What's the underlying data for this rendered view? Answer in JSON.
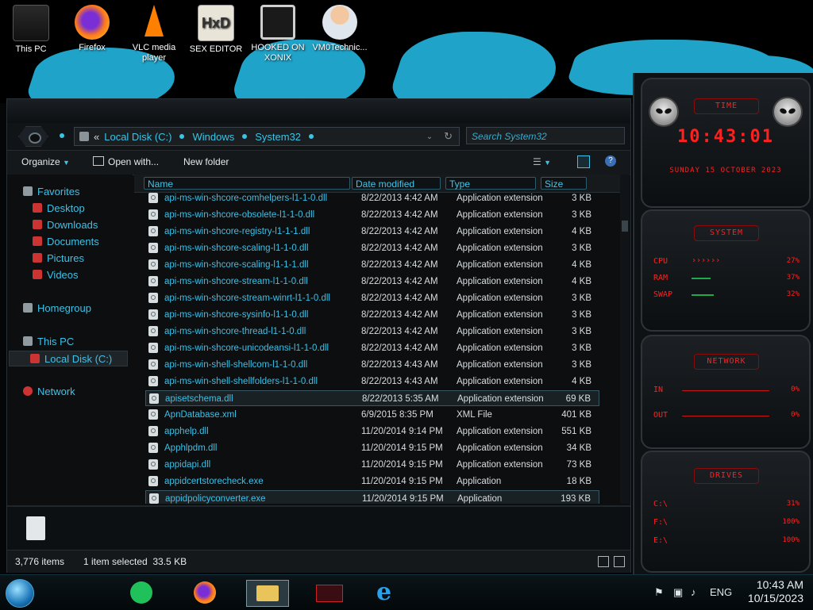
{
  "desktop": {
    "icons": [
      {
        "label": "This PC"
      },
      {
        "label": "Firefox"
      },
      {
        "label": "VLC media player"
      },
      {
        "label": "SEX EDITOR"
      },
      {
        "label": "HOOKED ON XONIX"
      },
      {
        "label": "VM0Technic..."
      }
    ]
  },
  "explorer": {
    "breadcrumb": [
      "Local Disk (C:)",
      "Windows",
      "System32"
    ],
    "breadcrumb_prefix": "«",
    "search_placeholder": "Search System32",
    "toolbar": {
      "organize": "Organize",
      "open_with": "Open with...",
      "new_folder": "New folder"
    },
    "nav": {
      "favorites": "Favorites",
      "desktop": "Desktop",
      "downloads": "Downloads",
      "documents": "Documents",
      "pictures": "Pictures",
      "videos": "Videos",
      "homegroup": "Homegroup",
      "this_pc": "This PC",
      "local_disk": "Local Disk (C:)",
      "network": "Network"
    },
    "columns": {
      "name": "Name",
      "date": "Date modified",
      "type": "Type",
      "size": "Size"
    },
    "files": [
      {
        "name": "api-ms-win-shcore-comhelpers-l1-1-0.dll",
        "date": "8/22/2013 4:42 AM",
        "type": "Application extension",
        "size": "3 KB"
      },
      {
        "name": "api-ms-win-shcore-obsolete-l1-1-0.dll",
        "date": "8/22/2013 4:42 AM",
        "type": "Application extension",
        "size": "3 KB"
      },
      {
        "name": "api-ms-win-shcore-registry-l1-1-1.dll",
        "date": "8/22/2013 4:42 AM",
        "type": "Application extension",
        "size": "4 KB"
      },
      {
        "name": "api-ms-win-shcore-scaling-l1-1-0.dll",
        "date": "8/22/2013 4:42 AM",
        "type": "Application extension",
        "size": "3 KB"
      },
      {
        "name": "api-ms-win-shcore-scaling-l1-1-1.dll",
        "date": "8/22/2013 4:42 AM",
        "type": "Application extension",
        "size": "4 KB"
      },
      {
        "name": "api-ms-win-shcore-stream-l1-1-0.dll",
        "date": "8/22/2013 4:42 AM",
        "type": "Application extension",
        "size": "4 KB"
      },
      {
        "name": "api-ms-win-shcore-stream-winrt-l1-1-0.dll",
        "date": "8/22/2013 4:42 AM",
        "type": "Application extension",
        "size": "3 KB"
      },
      {
        "name": "api-ms-win-shcore-sysinfo-l1-1-0.dll",
        "date": "8/22/2013 4:42 AM",
        "type": "Application extension",
        "size": "3 KB"
      },
      {
        "name": "api-ms-win-shcore-thread-l1-1-0.dll",
        "date": "8/22/2013 4:42 AM",
        "type": "Application extension",
        "size": "3 KB"
      },
      {
        "name": "api-ms-win-shcore-unicodeansi-l1-1-0.dll",
        "date": "8/22/2013 4:42 AM",
        "type": "Application extension",
        "size": "3 KB"
      },
      {
        "name": "api-ms-win-shell-shellcom-l1-1-0.dll",
        "date": "8/22/2013 4:43 AM",
        "type": "Application extension",
        "size": "3 KB"
      },
      {
        "name": "api-ms-win-shell-shellfolders-l1-1-0.dll",
        "date": "8/22/2013 4:43 AM",
        "type": "Application extension",
        "size": "4 KB"
      },
      {
        "name": "apisetschema.dll",
        "date": "8/22/2013 5:35 AM",
        "type": "Application extension",
        "size": "69 KB"
      },
      {
        "name": "ApnDatabase.xml",
        "date": "6/9/2015 8:35 PM",
        "type": "XML File",
        "size": "401 KB"
      },
      {
        "name": "apphelp.dll",
        "date": "11/20/2014 9:14 PM",
        "type": "Application extension",
        "size": "551 KB"
      },
      {
        "name": "Apphlpdm.dll",
        "date": "11/20/2014 9:15 PM",
        "type": "Application extension",
        "size": "34 KB"
      },
      {
        "name": "appidapi.dll",
        "date": "11/20/2014 9:15 PM",
        "type": "Application extension",
        "size": "73 KB"
      },
      {
        "name": "appidcertstorecheck.exe",
        "date": "11/20/2014 9:15 PM",
        "type": "Application",
        "size": "18 KB"
      },
      {
        "name": "appidpolicyconverter.exe",
        "date": "11/20/2014 9:15 PM",
        "type": "Application",
        "size": "193 KB"
      }
    ],
    "status": {
      "items": "3,776 items",
      "selected": "1 item selected  33.5 KB"
    }
  },
  "gadget": {
    "time_title": "TIME",
    "time": "10:43:01",
    "date": "SUNDAY 15 OCTOBER 2023",
    "system_title": "SYSTEM",
    "cpu_label": "CPU",
    "cpu_value": "27%",
    "ram_label": "RAM",
    "ram_value": "37%",
    "swap_label": "SWAP",
    "swap_value": "32%",
    "network_title": "NETWORK",
    "in_label": "IN",
    "in_value": "0%",
    "out_label": "OUT",
    "out_value": "0%",
    "drives_title": "DRIVES",
    "drive_c_label": "C:\\",
    "drive_c_value": "31%",
    "drive_f_label": "F:\\",
    "drive_f_value": "100%",
    "drive_e_label": "E:\\",
    "drive_e_value": "100%"
  },
  "taskbar": {
    "lang": "ENG",
    "time": "10:43 AM",
    "date": "10/15/2023"
  },
  "colors": {
    "accent": "#3cc0e6",
    "gadget_red": "#ff2020",
    "wallpaper_brush": "#1fa3c9"
  }
}
